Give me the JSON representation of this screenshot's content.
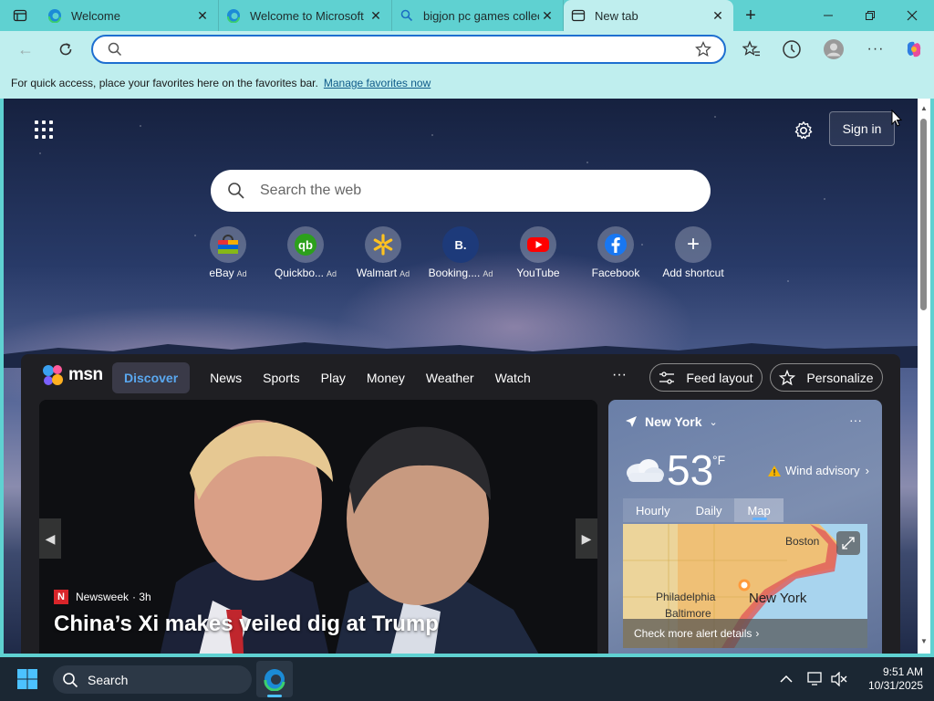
{
  "tabs": [
    {
      "title": "Welcome",
      "active": false
    },
    {
      "title": "Welcome to Microsoft E",
      "active": false
    },
    {
      "title": "bigjon pc games collect",
      "active": false
    },
    {
      "title": "New tab",
      "active": true
    }
  ],
  "address_bar": {
    "value": "",
    "placeholder": ""
  },
  "favorites_bar": {
    "message": "For quick access, place your favorites here on the favorites bar.",
    "link": "Manage favorites now"
  },
  "newtab": {
    "sign_in": "Sign in",
    "search_placeholder": "Search the web",
    "shortcuts": [
      {
        "label": "eBay",
        "ad": "Ad"
      },
      {
        "label": "Quickbo...",
        "ad": "Ad"
      },
      {
        "label": "Walmart",
        "ad": "Ad"
      },
      {
        "label": "Booking....",
        "ad": "Ad"
      },
      {
        "label": "YouTube",
        "ad": ""
      },
      {
        "label": "Facebook",
        "ad": ""
      },
      {
        "label": "Add shortcut",
        "ad": ""
      }
    ]
  },
  "feed": {
    "brand": "msn",
    "tabs": [
      "Discover",
      "News",
      "Sports",
      "Play",
      "Money",
      "Weather",
      "Watch"
    ],
    "active_tab": "Discover",
    "more": "···",
    "feed_layout": "Feed layout",
    "personalize": "Personalize",
    "hero": {
      "source": "Newsweek",
      "source_initial": "N",
      "age": "· 3h",
      "headline": "China’s Xi makes veiled dig at Trump"
    },
    "weather": {
      "location": "New York",
      "more": "···",
      "temperature": "53",
      "unit": "°F",
      "alert": "Wind advisory",
      "tabs": [
        "Hourly",
        "Daily",
        "Map"
      ],
      "active_tab": "Map",
      "map_labels": {
        "boston": "Boston",
        "philadelphia": "Philadelphia",
        "baltimore": "Baltimore",
        "newyork": "New York"
      },
      "alert_link": "Check more alert details"
    }
  },
  "taskbar": {
    "search": "Search",
    "time": "9:51 AM",
    "date": "10/31/2025"
  },
  "colors": {
    "titlebar": "#5fd1d1",
    "toolbar": "#bfeeee",
    "accent": "#1e6fd0",
    "feed_bg": "#1f1f23",
    "discover": "#5aa8f0"
  }
}
